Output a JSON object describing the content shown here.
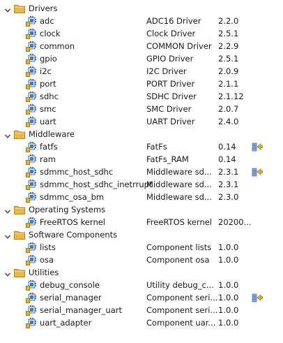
{
  "categories": [
    {
      "label": "Drivers",
      "items": [
        {
          "name": "adc",
          "description": "ADC16 Driver",
          "version": "2.2.0",
          "action": false
        },
        {
          "name": "clock",
          "description": "Clock Driver",
          "version": "2.5.1",
          "action": false
        },
        {
          "name": "common",
          "description": "COMMON Driver",
          "version": "2.2.9",
          "action": false
        },
        {
          "name": "gpio",
          "description": "GPIO Driver",
          "version": "2.5.1",
          "action": false
        },
        {
          "name": "i2c",
          "description": "I2C Driver",
          "version": "2.0.9",
          "action": false
        },
        {
          "name": "port",
          "description": "PORT Driver",
          "version": "2.1.1",
          "action": false
        },
        {
          "name": "sdhc",
          "description": "SDHC Driver",
          "version": "2.1.12",
          "action": false
        },
        {
          "name": "smc",
          "description": "SMC Driver",
          "version": "2.0.7",
          "action": false
        },
        {
          "name": "uart",
          "description": "UART Driver",
          "version": "2.4.0",
          "action": false
        }
      ]
    },
    {
      "label": "Middleware",
      "items": [
        {
          "name": "fatfs",
          "description": "FatFs",
          "version": "0.14",
          "action": true
        },
        {
          "name": "ram",
          "description": "FatFs_RAM",
          "version": "0.14",
          "action": false
        },
        {
          "name": "sdmmc_host_sdhc",
          "description": "Middleware sd...",
          "version": "2.3.1",
          "action": true
        },
        {
          "name": "sdmmc_host_sdhc_inetrrupt",
          "description": "Middleware sd...",
          "version": "2.3.1",
          "action": false
        },
        {
          "name": "sdmmc_osa_bm",
          "description": "Middleware sd...",
          "version": "2.3.0",
          "action": false
        }
      ]
    },
    {
      "label": "Operating Systems",
      "items": [
        {
          "name": "FreeRTOS kernel",
          "description": "FreeRTOS kernel",
          "version": "20200...",
          "action": false
        }
      ]
    },
    {
      "label": "Software Components",
      "items": [
        {
          "name": "lists",
          "description": "Component lists",
          "version": "1.0.0",
          "action": false
        },
        {
          "name": "osa",
          "description": "Component osa",
          "version": "1.0.0",
          "action": false
        }
      ]
    },
    {
      "label": "Utilities",
      "items": [
        {
          "name": "debug_console",
          "description": "Utility debug_c...",
          "version": "1.0.0",
          "action": false
        },
        {
          "name": "serial_manager",
          "description": "Component seri...",
          "version": "1.0.0",
          "action": true
        },
        {
          "name": "serial_manager_uart",
          "description": "Component seri...",
          "version": "1.0.0",
          "action": false
        },
        {
          "name": "uart_adapter",
          "description": "Component uar...",
          "version": "1.0.0",
          "action": false
        }
      ]
    }
  ],
  "icons": {
    "toggle": "chevron-down-icon",
    "category": "folder-icon",
    "component": "component-plugin-icon",
    "action": "multi-action-icon"
  },
  "colors": {
    "folder": "#e8b84a",
    "folder_dark": "#b8862a",
    "component_blue": "#4a76b8",
    "component_yellow": "#e0b040"
  }
}
